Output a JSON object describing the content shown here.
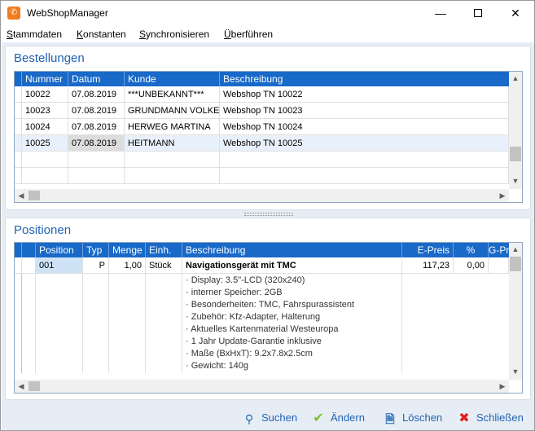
{
  "window": {
    "title": "WebShopManager",
    "icon": "webshop-logo-icon"
  },
  "menu": [
    {
      "label": "Stammdaten"
    },
    {
      "label": "Konstanten"
    },
    {
      "label": "Synchronisieren"
    },
    {
      "label": "Überführen"
    }
  ],
  "orders": {
    "title": "Bestellungen",
    "columns": [
      "Nummer",
      "Datum",
      "Kunde",
      "Beschreibung"
    ],
    "rows": [
      {
        "nummer": "10022",
        "datum": "07.08.2019",
        "kunde": "***UNBEKANNT***",
        "beschreibung": "Webshop TN 10022"
      },
      {
        "nummer": "10023",
        "datum": "07.08.2019",
        "kunde": "GRUNDMANN VOLKER",
        "beschreibung": "Webshop TN 10023"
      },
      {
        "nummer": "10024",
        "datum": "07.08.2019",
        "kunde": "HERWEG MARTINA",
        "beschreibung": "Webshop TN 10024"
      },
      {
        "nummer": "10025",
        "datum": "07.08.2019",
        "kunde": "HEITMANN",
        "beschreibung": "Webshop TN 10025"
      }
    ]
  },
  "positions": {
    "title": "Positionen",
    "columns": [
      "Position",
      "Typ",
      "Menge",
      "Einh.",
      "Beschreibung",
      "E-Preis",
      "%",
      "G-Preis"
    ],
    "row": {
      "position": "001",
      "typ": "P",
      "menge": "1,00",
      "einheit": "Stück",
      "beschreibung": "Navigationsgerät mit TMC",
      "epreis": "117,23",
      "rabatt": "0,00"
    },
    "details": [
      "· Display: 3.5\"-LCD (320x240)",
      "· interner Speicher: 2GB",
      "· Besonderheiten: TMC, Fahrspurassistent",
      "· Zubehör: Kfz-Adapter, Halterung",
      "· Aktuelles Kartenmaterial Westeuropa",
      "· 1 Jahr Update-Garantie inklusive",
      "· Maße (BxHxT): 9.2x7.8x2.5cm",
      "· Gewicht: 140g"
    ]
  },
  "toolbar": {
    "search": "Suchen",
    "edit": "Ändern",
    "delete": "Löschen",
    "close": "Schließen"
  }
}
